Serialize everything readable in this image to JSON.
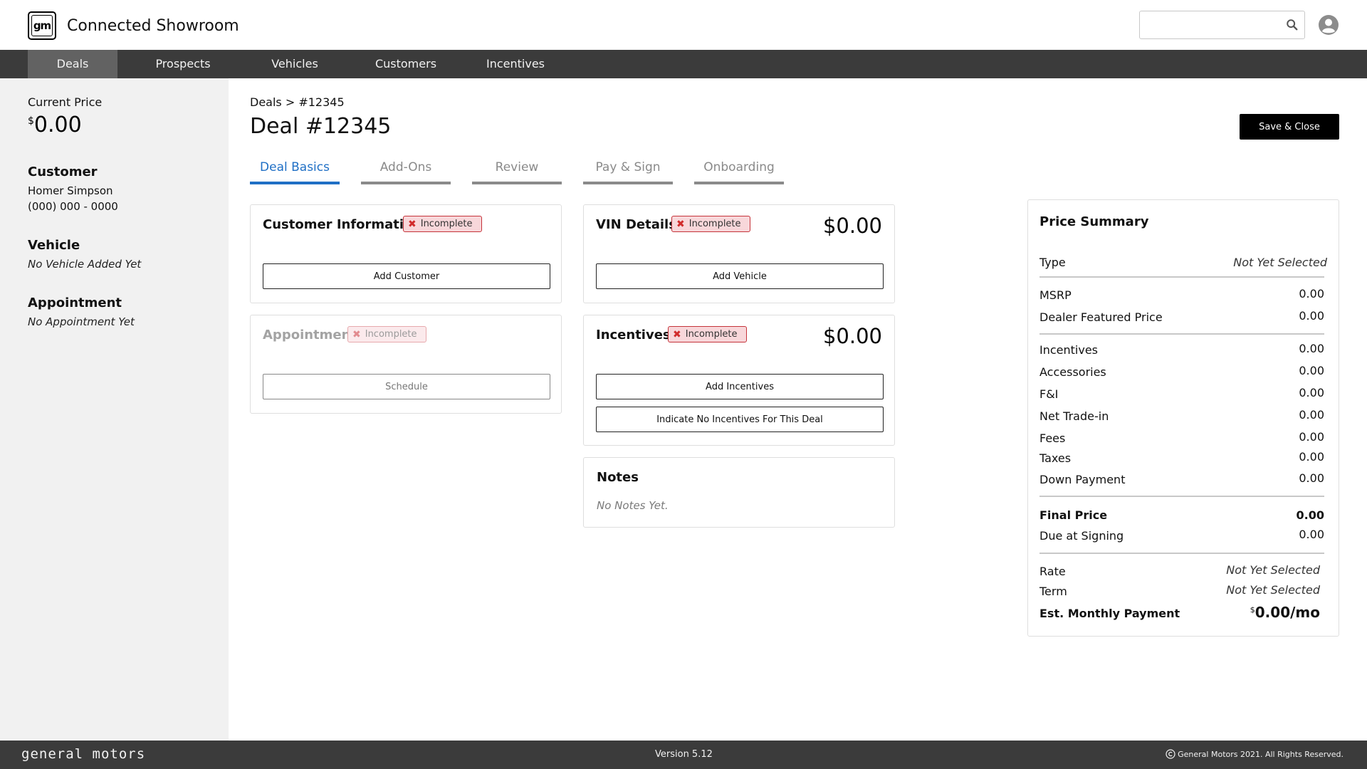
{
  "header": {
    "logo_text": "gm",
    "app_title": "Connected Showroom",
    "search": {
      "value": "",
      "placeholder": ""
    },
    "search_icon": "search-icon",
    "avatar_icon": "user-avatar-icon"
  },
  "nav": {
    "items": [
      {
        "label": "Deals",
        "active": true
      },
      {
        "label": "Prospects",
        "active": false
      },
      {
        "label": "Vehicles",
        "active": false
      },
      {
        "label": "Customers",
        "active": false
      },
      {
        "label": "Incentives",
        "active": false
      }
    ]
  },
  "sidebar": {
    "current_price_label": "Current Price",
    "current_price_currency": "$",
    "current_price_value": "0.00",
    "customer_heading": "Customer",
    "customer_name": "Homer Simpson",
    "customer_phone": "(000) 000 - 0000",
    "vehicle_heading": "Vehicle",
    "vehicle_value": "No Vehicle Added Yet",
    "appointment_heading": "Appointment",
    "appointment_value": "No Appointment Yet"
  },
  "main": {
    "breadcrumb": "Deals > #12345",
    "title": "Deal #12345",
    "save_label": "Save & Close",
    "tabs": [
      {
        "label": "Deal Basics",
        "active": true
      },
      {
        "label": "Add-Ons",
        "active": false
      },
      {
        "label": "Review",
        "active": false
      },
      {
        "label": "Pay & Sign",
        "active": false
      },
      {
        "label": "Onboarding",
        "active": false
      }
    ]
  },
  "cards": {
    "customer_info": {
      "title": "Customer Information",
      "status": "Incomplete",
      "button": "Add Customer"
    },
    "appointment": {
      "title": "Appointment",
      "status": "Incomplete",
      "button": "Schedule",
      "disabled": true
    },
    "vin": {
      "title": "VIN Details",
      "status": "Incomplete",
      "amount": "$0.00",
      "button": "Add Vehicle"
    },
    "incentives": {
      "title": "Incentives",
      "status": "Incomplete",
      "amount": "$0.00",
      "button_add": "Add Incentives",
      "button_none": "Indicate No Incentives For This Deal"
    },
    "notes": {
      "title": "Notes",
      "empty_text": "No Notes Yet."
    }
  },
  "price_summary": {
    "title": "Price Summary",
    "type": {
      "label": "Type",
      "value": "Not Yet Selected"
    },
    "msrp": {
      "label": "MSRP",
      "value": "0.00"
    },
    "dealer_featured": {
      "label": "Dealer Featured Price",
      "value": "0.00"
    },
    "incentives": {
      "label": "Incentives",
      "value": "0.00"
    },
    "accessories": {
      "label": "Accessories",
      "value": "0.00"
    },
    "fni": {
      "label": "F&I",
      "value": "0.00"
    },
    "net_trade": {
      "label": "Net Trade-in",
      "value": "0.00"
    },
    "fees": {
      "label": "Fees",
      "value": "0.00"
    },
    "taxes": {
      "label": "Taxes",
      "value": "0.00"
    },
    "down_payment": {
      "label": "Down Payment",
      "value": "0.00"
    },
    "final_price": {
      "label": "Final Price",
      "value": "0.00"
    },
    "due_at_signing": {
      "label": "Due at Signing",
      "value": "0.00"
    },
    "rate": {
      "label": "Rate",
      "value": "Not Yet Selected"
    },
    "term": {
      "label": "Term",
      "value": "Not Yet Selected"
    },
    "monthly": {
      "label": "Est. Monthly Payment",
      "currency": "$",
      "value": "0.00/mo"
    }
  },
  "footer": {
    "brand": "general motors",
    "version": "Version 5.12",
    "copyright": "General Motors 2021. All Rights Reserved."
  },
  "colors": {
    "nav_bg": "#3b3b3b",
    "nav_active": "#626262",
    "tab_active": "#1f6fc5",
    "badge_border": "#c5333a",
    "badge_bg": "#f8d7da",
    "sidebar_bg": "#f1f1f1"
  }
}
